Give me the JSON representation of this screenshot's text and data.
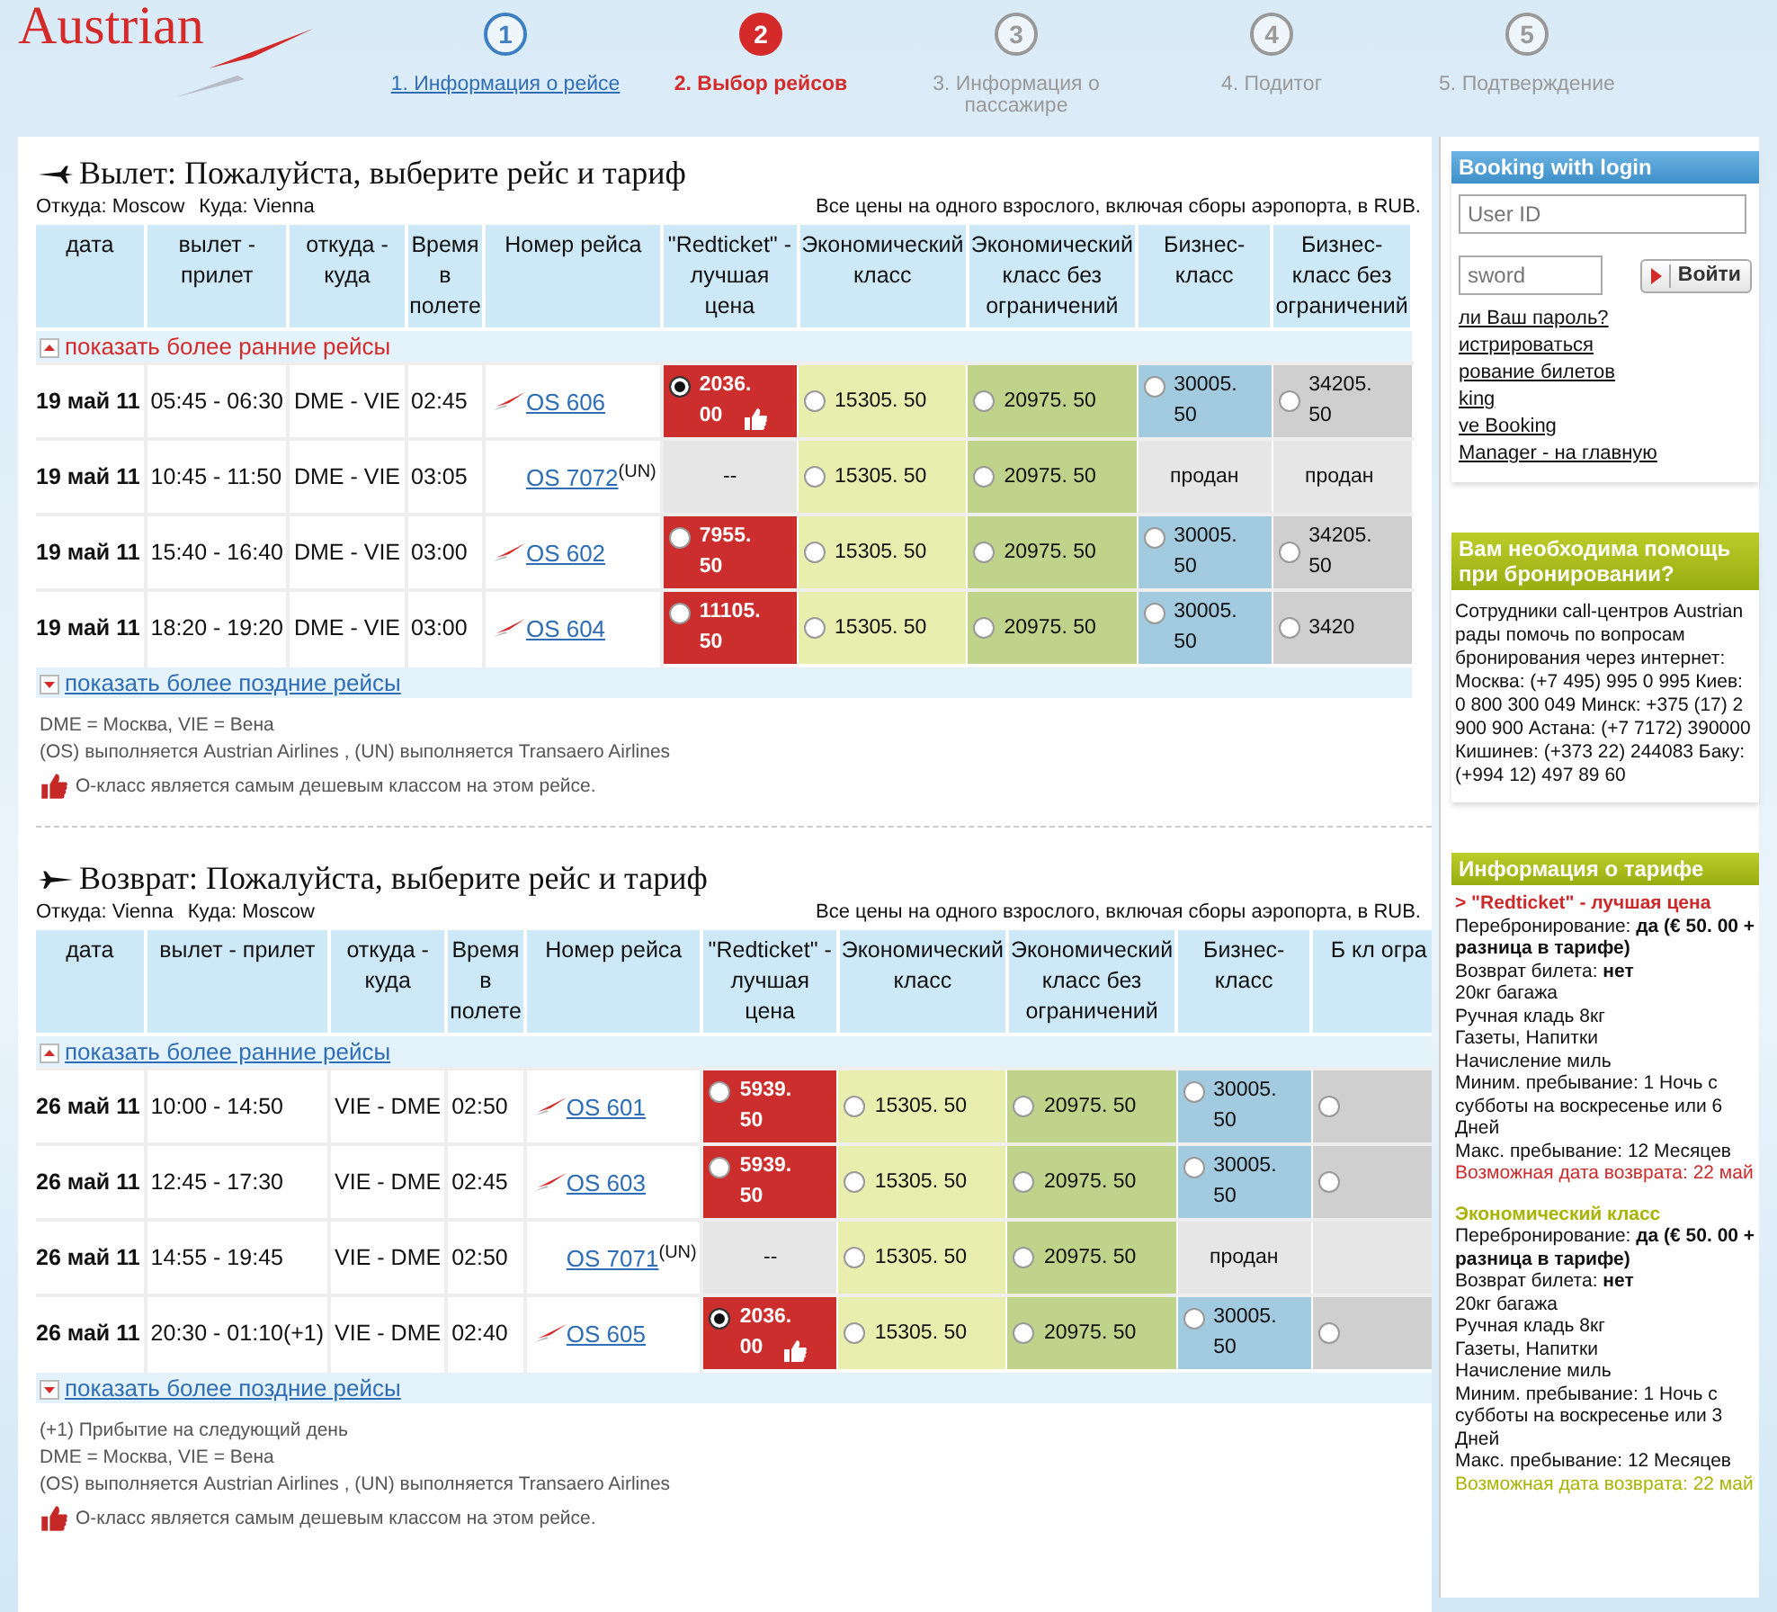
{
  "header": {
    "logo": "Austrian",
    "steps": [
      {
        "number": "1",
        "label": "1. Информация о рейсе",
        "selected": false,
        "completed": true
      },
      {
        "number": "2",
        "label": "2. Выбор рейсов",
        "selected": true,
        "completed": false
      },
      {
        "number": "3",
        "label": "3. Информация о пассажире",
        "selected": false,
        "completed": false
      },
      {
        "number": "4",
        "label": "4. Подитог",
        "selected": false,
        "completed": false
      },
      {
        "number": "5",
        "label": "5. Подтверждение",
        "selected": false,
        "completed": false
      }
    ]
  },
  "sections": [
    {
      "return": false,
      "title": "Вылет: Пожалуйста, выберите рейс и тариф",
      "from": "Откуда: Moscow",
      "to": "Куда: Vienna",
      "price_note": "Все цены на одного взрослого, включая сборы аэропорта, в RUB.",
      "columns": [
        "дата",
        "вылет - прилет",
        "откуда - куда",
        "Время в полете",
        "Номер рейса",
        "\"Redticket\" - лучшая цена",
        "Экономический класс",
        "Экономический класс без ограничений",
        "Бизнес-класс",
        "Бизнес-класс без ограничений"
      ],
      "earlier": {
        "label": "показать более ранние рейсы",
        "highlighted": true
      },
      "rows": [
        {
          "date": "19 май 11",
          "times": "05:45 - 06:30",
          "route": "DME - VIE",
          "duration": "02:45",
          "flight": "OS 606",
          "logo": true,
          "fares": [
            {
              "price": "2036. 00",
              "radio": true,
              "selected": true,
              "best": true
            },
            {
              "price": "15305. 50",
              "radio": true,
              "selected": false,
              "best": false
            },
            {
              "price": "20975. 50",
              "radio": true,
              "selected": false,
              "best": false
            },
            {
              "price": "30005. 50",
              "radio": true,
              "selected": false,
              "best": false
            },
            {
              "price": "34205. 50",
              "radio": true,
              "selected": false,
              "best": false
            }
          ]
        },
        {
          "date": "19 май 11",
          "times": "10:45 - 11:50",
          "route": "DME - VIE",
          "duration": "03:05",
          "flight": "OS 7072",
          "operator": "(UN)",
          "logo": false,
          "fares": [
            {
              "price": "--",
              "radio": false
            },
            {
              "price": "15305. 50",
              "radio": true,
              "selected": false,
              "best": false
            },
            {
              "price": "20975. 50",
              "radio": true,
              "selected": false,
              "best": false
            },
            {
              "price": "продан",
              "radio": false
            },
            {
              "price": "продан",
              "radio": false
            }
          ]
        },
        {
          "date": "19 май 11",
          "times": "15:40 - 16:40",
          "route": "DME - VIE",
          "duration": "03:00",
          "flight": "OS 602",
          "logo": true,
          "fares": [
            {
              "price": "7955. 50",
              "radio": true,
              "selected": false,
              "best": false
            },
            {
              "price": "15305. 50",
              "radio": true,
              "selected": false,
              "best": false
            },
            {
              "price": "20975. 50",
              "radio": true,
              "selected": false,
              "best": false
            },
            {
              "price": "30005. 50",
              "radio": true,
              "selected": false,
              "best": false
            },
            {
              "price": "34205. 50",
              "radio": true,
              "selected": false,
              "best": false
            }
          ]
        },
        {
          "date": "19 май 11",
          "times": "18:20 - 19:20",
          "route": "DME - VIE",
          "duration": "03:00",
          "flight": "OS 604",
          "logo": true,
          "fares": [
            {
              "price": "11105. 50",
              "radio": true,
              "selected": false,
              "best": false
            },
            {
              "price": "15305. 50",
              "radio": true,
              "selected": false,
              "best": false
            },
            {
              "price": "20975. 50",
              "radio": true,
              "selected": false,
              "best": false
            },
            {
              "price": "30005. 50",
              "radio": true,
              "selected": false,
              "best": false
            },
            {
              "price": "3420",
              "radio": true,
              "selected": false,
              "best": false
            }
          ]
        }
      ],
      "later": {
        "label": "показать более поздние рейсы",
        "highlighted": false
      },
      "notes": [
        "DME = Москва, VIE = Вена",
        "(OS) выполняется Austrian Airlines , (UN) выполняется Transaero Airlines"
      ],
      "best_note": "О-класс является самым дешевым классом на этом рейсе."
    },
    {
      "return": true,
      "title": "Возврат: Пожалуйста, выберите рейс и тариф",
      "from": "Откуда: Vienna",
      "to": "Куда: Moscow",
      "price_note": "Все цены на одного взрослого, включая сборы аэропорта, в RUB.",
      "columns": [
        "дата",
        "вылет - прилет",
        "откуда - куда",
        "Время в полете",
        "Номер рейса",
        "\"Redticket\" - лучшая цена",
        "Экономический класс",
        "Экономический класс без ограничений",
        "Бизнес-класс",
        "Б кл огра"
      ],
      "earlier": {
        "label": "показать более ранние рейсы",
        "highlighted": false
      },
      "rows": [
        {
          "date": "26 май 11",
          "times": "10:00 - 14:50",
          "route": "VIE - DME",
          "duration": "02:50",
          "flight": "OS 601",
          "logo": true,
          "fares": [
            {
              "price": "5939. 50",
              "radio": true,
              "selected": false,
              "best": false
            },
            {
              "price": "15305. 50",
              "radio": true,
              "selected": false,
              "best": false
            },
            {
              "price": "20975. 50",
              "radio": true,
              "selected": false,
              "best": false
            },
            {
              "price": "30005. 50",
              "radio": true,
              "selected": false,
              "best": false
            },
            {
              "radio": true,
              "selected": false,
              "best": false
            }
          ]
        },
        {
          "date": "26 май 11",
          "times": "12:45 - 17:30",
          "route": "VIE - DME",
          "duration": "02:45",
          "flight": "OS 603",
          "logo": true,
          "fares": [
            {
              "price": "5939. 50",
              "radio": true,
              "selected": false,
              "best": false
            },
            {
              "price": "15305. 50",
              "radio": true,
              "selected": false,
              "best": false
            },
            {
              "price": "20975. 50",
              "radio": true,
              "selected": false,
              "best": false
            },
            {
              "price": "30005. 50",
              "radio": true,
              "selected": false,
              "best": false
            },
            {
              "radio": true,
              "selected": false,
              "best": false
            }
          ]
        },
        {
          "date": "26 май 11",
          "times": "14:55 - 19:45",
          "route": "VIE - DME",
          "duration": "02:50",
          "flight": "OS 7071",
          "operator": "(UN)",
          "logo": false,
          "fares": [
            {
              "price": "--",
              "radio": false
            },
            {
              "price": "15305. 50",
              "radio": true,
              "selected": false,
              "best": false
            },
            {
              "price": "20975. 50",
              "radio": true,
              "selected": false,
              "best": false
            },
            {
              "price": "продан",
              "radio": false
            },
            {
              "radio": false
            }
          ]
        },
        {
          "date": "26 май 11",
          "times": "20:30 - 01:10(+1)",
          "route": "VIE - DME",
          "duration": "02:40",
          "flight": "OS 605",
          "logo": true,
          "fares": [
            {
              "price": "2036. 00",
              "radio": true,
              "selected": true,
              "best": true
            },
            {
              "price": "15305. 50",
              "radio": true,
              "selected": false,
              "best": false
            },
            {
              "price": "20975. 50",
              "radio": true,
              "selected": false,
              "best": false
            },
            {
              "price": "30005. 50",
              "radio": true,
              "selected": false,
              "best": false
            },
            {
              "radio": true,
              "selected": false,
              "best": false
            }
          ]
        }
      ],
      "later": {
        "label": "показать более поздние рейсы",
        "highlighted": false
      },
      "notes": [
        "(+1) Прибытие на следующий день",
        "DME = Москва, VIE = Вена",
        "(OS) выполняется Austrian Airlines , (UN) выполняется Transaero Airlines"
      ],
      "best_note": "О-класс является самым дешевым классом на этом рейсе."
    }
  ],
  "sidebar": {
    "login": {
      "title": "Booking with login",
      "user_placeholder": "User ID",
      "password_placeholder": "sword",
      "button": "Войти",
      "links": [
        "ли Ваш пароль?",
        "истрироваться",
        "рование билетов",
        "king",
        "ve Booking",
        "Manager - на главную"
      ]
    },
    "help": {
      "title": "Вам необходима помощь при бронировании?",
      "text": "Сотрудники call-центров Austrian рады помочь по вопросам бронирования через интернет: Москва: (+7 495) 995 0 995 Киев: 0 800 300 049 Минск: +375 (17) 2 900 900 Астана: (+7 7172) 390000 Кишинев: (+373 22) 244083 Баку: (+994 12) 497 89 60"
    },
    "tariff": {
      "title": "Информация о тарифе",
      "fares": [
        {
          "name": "> \"Redticket\" - лучшая цена",
          "color": "#cc2a2a",
          "lines": [
            "Перебронирование: **да (€ 50. 00 + разница в тарифе)**",
            "Возврат билета: **нет**",
            "20кг багажа",
            "Ручная кладь 8кг",
            "Газеты, Напитки",
            "Начисление миль",
            "Миним. пребывание: 1 Ночь с субботы на воскресенье или 6 Дней",
            "Макс. пребывание: 12 Месяцев"
          ],
          "return_date": "Возможная дата возврата: 22 май"
        },
        {
          "name": "Экономический класс",
          "color": "#a8b400",
          "lines": [
            "Перебронирование: **да (€ 50. 00 + разница в тарифе)**",
            "Возврат билета: **нет**",
            "20кг багажа",
            "Ручная кладь 8кг",
            "Газеты, Напитки",
            "Начисление миль",
            "Миним. пребывание: 1 Ночь с субботы на воскресенье или 3 Дней",
            "Макс. пребывание: 12 Месяцев"
          ],
          "return_date": "Возможная дата возврата: 22 май"
        }
      ]
    }
  }
}
